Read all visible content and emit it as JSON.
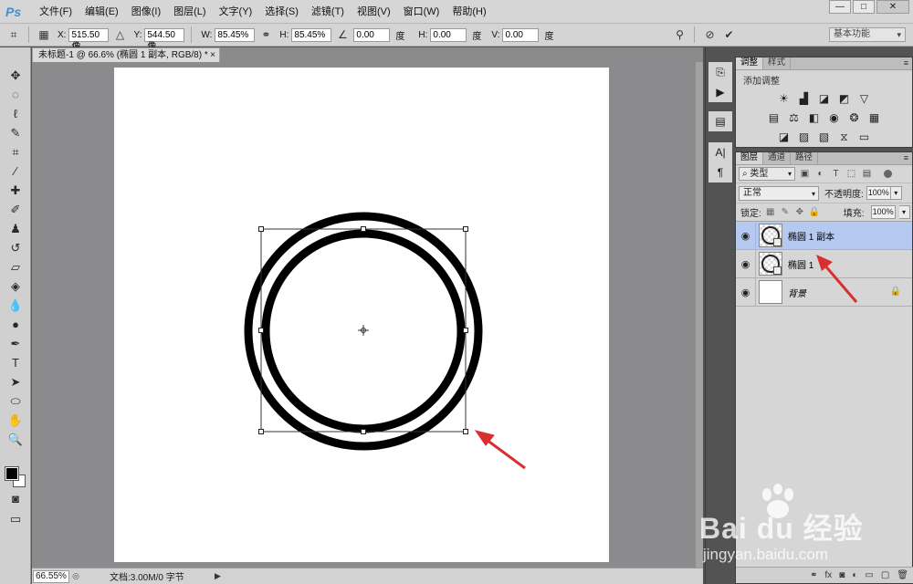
{
  "app": {
    "logo": "Ps"
  },
  "menu": [
    "文件(F)",
    "编辑(E)",
    "图像(I)",
    "图层(L)",
    "文字(Y)",
    "选择(S)",
    "滤镜(T)",
    "视图(V)",
    "窗口(W)",
    "帮助(H)"
  ],
  "options": {
    "x_label": "X:",
    "x_value": "515.50 像",
    "y_label": "Y:",
    "y_value": "544.50 像",
    "w_label": "W:",
    "w_value": "85.45%",
    "h_label": "H:",
    "h_value": "85.45%",
    "angle_value": "0.00",
    "angle_unit": "度",
    "hskew_label": "H:",
    "hskew_value": "0.00",
    "hskew_unit": "度",
    "vskew_label": "V:",
    "vskew_value": "0.00",
    "vskew_unit": "度",
    "workspace": "基本功能"
  },
  "document": {
    "tab_title": "未标题-1 @ 66.6% (椭圆 1 副本, RGB/8) *",
    "close_glyph": "×",
    "zoom": "66.55%",
    "doc_size": "文档:3.00M/0 字节"
  },
  "adjustments": {
    "tabs": [
      "调整",
      "样式"
    ],
    "title": "添加调整"
  },
  "layers_panel": {
    "tabs": [
      "图层",
      "通道",
      "路径"
    ],
    "filter_kind": "类型",
    "blend_mode": "正常",
    "opacity_label": "不透明度:",
    "opacity_value": "100%",
    "lock_label": "锁定:",
    "fill_label": "填充:",
    "fill_value": "100%",
    "layers": [
      {
        "name": "椭圆 1 副本",
        "selected": true
      },
      {
        "name": "椭圆 1",
        "selected": false
      },
      {
        "name": "背景",
        "selected": false
      }
    ]
  },
  "watermark": {
    "brand": "Bai du 经验",
    "url": "jingyan.baidu.com"
  },
  "colors": {
    "arrow": "#d9302f",
    "selection": "#b6c9f0",
    "canvas_bg": "#8b8b8e"
  }
}
